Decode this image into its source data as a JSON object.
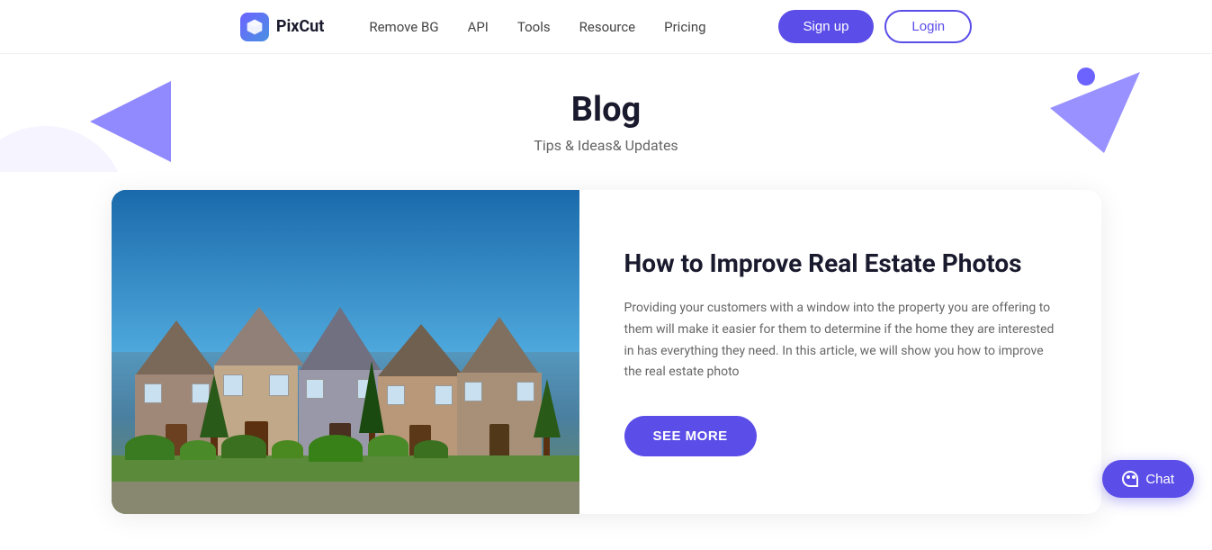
{
  "navbar": {
    "logo_text": "PixCut",
    "links": [
      {
        "id": "remove-bg",
        "label": "Remove BG"
      },
      {
        "id": "api",
        "label": "API"
      },
      {
        "id": "tools",
        "label": "Tools"
      },
      {
        "id": "resource",
        "label": "Resource"
      },
      {
        "id": "pricing",
        "label": "Pricing"
      }
    ],
    "signup_label": "Sign up",
    "login_label": "Login"
  },
  "hero": {
    "title": "Blog",
    "subtitle": "Tips & Ideas& Updates"
  },
  "card": {
    "title": "How to Improve Real Estate Photos",
    "description": "Providing your customers with a window into the property you are offering to them will make it easier for them to determine if the home they are interested in has everything they need. In this article, we will show you how to improve the real estate photo",
    "see_more_label": "SEE MORE"
  },
  "chat": {
    "label": "Chat"
  }
}
